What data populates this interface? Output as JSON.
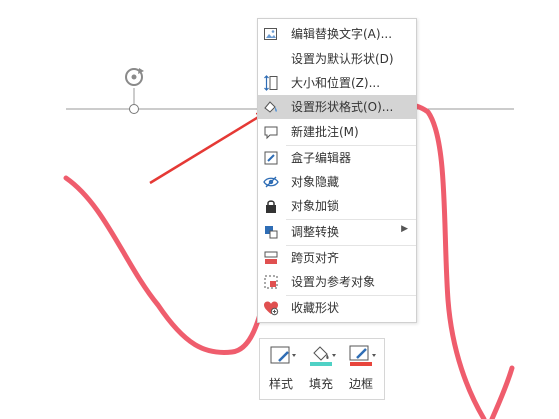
{
  "menu": {
    "items": [
      {
        "label": "编辑替换文字(A)...",
        "icon": "image-alt-text-icon"
      },
      {
        "label": "设置为默认形状(D)",
        "icon": "none"
      },
      {
        "label": "大小和位置(Z)...",
        "icon": "size-position-icon"
      },
      {
        "label": "设置形状格式(O)...",
        "icon": "format-shape-icon",
        "highlighted": true
      },
      {
        "label": "新建批注(M)",
        "icon": "new-comment-icon"
      },
      {
        "label": "盒子编辑器",
        "icon": "box-editor-icon"
      },
      {
        "label": "对象隐藏",
        "icon": "eye-hide-icon"
      },
      {
        "label": "对象加锁",
        "icon": "lock-icon"
      },
      {
        "label": "调整转换",
        "icon": "adjust-convert-icon",
        "has_submenu": true
      },
      {
        "label": "跨页对齐",
        "icon": "cross-page-align-icon"
      },
      {
        "label": "设置为参考对象",
        "icon": "reference-object-icon"
      },
      {
        "label": "收藏形状",
        "icon": "favorite-shape-icon"
      }
    ]
  },
  "toolbar": {
    "style_label": "样式",
    "fill_label": "填充",
    "border_label": "边框"
  },
  "colors": {
    "curve": "#ef5d6d",
    "arrow": "#e53935",
    "highlight": "#d4d4d4",
    "fill_accent": "#4fd1c5",
    "border_accent": "#e8453c"
  }
}
